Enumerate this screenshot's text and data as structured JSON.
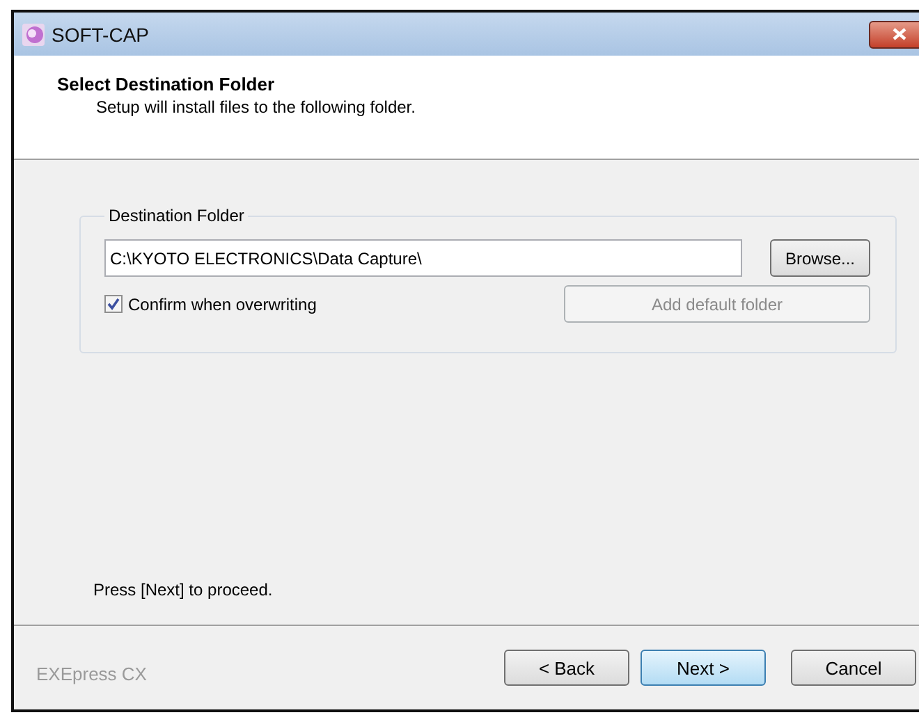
{
  "window": {
    "title": "SOFT-CAP"
  },
  "header": {
    "title": "Select Destination Folder",
    "subtitle": "Setup will install files to the following folder."
  },
  "group": {
    "label": "Destination Folder",
    "path_field": {
      "value": "C:\\KYOTO ELECTRONICS\\Data Capture\\"
    },
    "browse_button": {
      "label": "Browse...",
      "disabled": false
    },
    "confirm_checkbox": {
      "label": "Confirm when overwriting",
      "checked": true
    },
    "add_default_button": {
      "label": "Add default folder",
      "disabled": true
    }
  },
  "hint": "Press [Next] to proceed.",
  "brand": "EXEpress CX",
  "buttons": [
    {
      "label": "< Back",
      "default": false
    },
    {
      "label": "Next >",
      "default": true
    },
    {
      "label": "Cancel",
      "default": false
    }
  ]
}
